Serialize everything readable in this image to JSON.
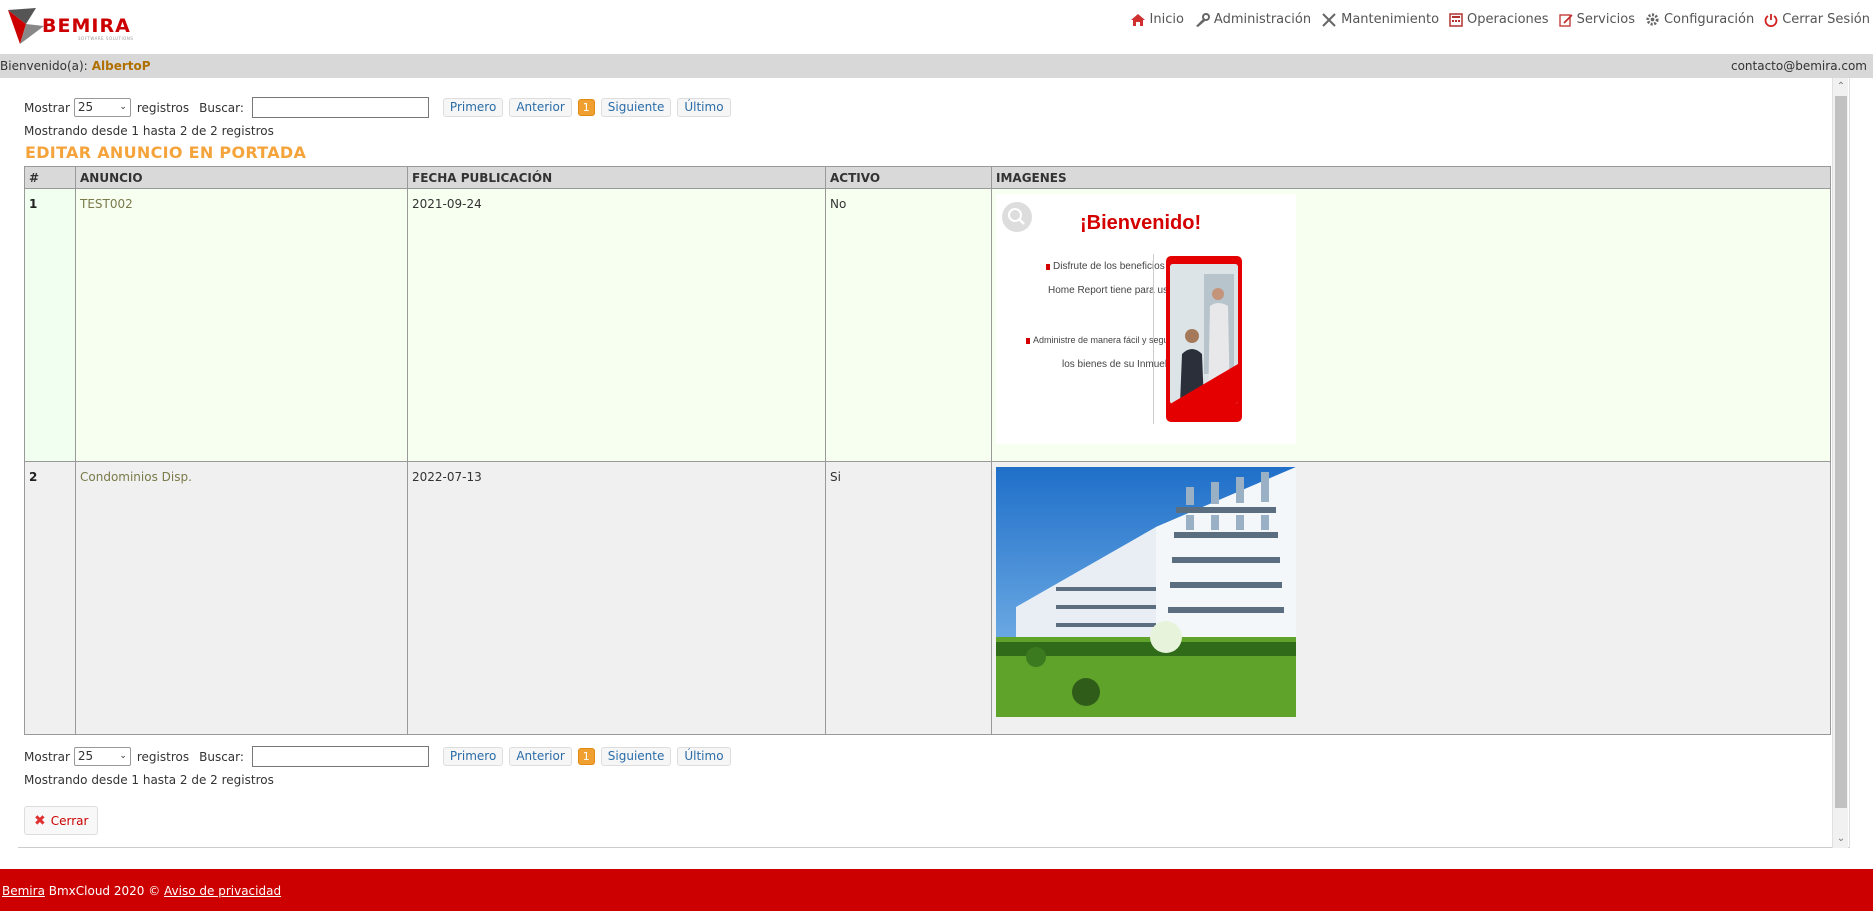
{
  "header": {
    "logo_text": "BEMIRA",
    "logo_sub": "SOFTWARE SOLUTIONS",
    "nav": [
      {
        "label": "Inicio",
        "icon": "home-icon"
      },
      {
        "label": "Administración",
        "icon": "wrench-icon"
      },
      {
        "label": "Mantenimiento",
        "icon": "tools-icon"
      },
      {
        "label": "Operaciones",
        "icon": "calculator-icon"
      },
      {
        "label": "Servicios",
        "icon": "edit-icon"
      },
      {
        "label": "Configuración",
        "icon": "gear-icon"
      },
      {
        "label": "Cerrar Sesión",
        "icon": "power-icon"
      }
    ]
  },
  "welcome": {
    "prefix": "Bienvenido(a):",
    "user": "AlbertoP",
    "email": "contacto@bemira.com"
  },
  "controls": {
    "show_label": "Mostrar",
    "page_size": "25",
    "records_label": "registros",
    "search_label": "Buscar:",
    "search_value": "",
    "first": "Primero",
    "prev": "Anterior",
    "current_page": "1",
    "next": "Siguiente",
    "last": "Último",
    "info": "Mostrando desde 1 hasta 2 de 2 registros"
  },
  "section_title": "EDITAR ANUNCIO EN PORTADA",
  "table": {
    "headers": [
      "#",
      "ANUNCIO",
      "FECHA PUBLICACIÓN",
      "ACTIVO",
      "IMAGENES"
    ],
    "rows": [
      {
        "num": "1",
        "anuncio": "TEST002",
        "fecha": "2021-09-24",
        "activo": "No"
      },
      {
        "num": "2",
        "anuncio": "Condominios Disp.",
        "fecha": "2022-07-13",
        "activo": "Si"
      }
    ],
    "image1": {
      "title": "¡Bienvenido!",
      "bullet1_line1": "Disfrute de los beneficios que",
      "bullet1_line2": "Home Report tiene para usted.",
      "bullet2_line1": "Administre de manera fácil y segura",
      "bullet2_line2": "los bienes de su Inmueble."
    }
  },
  "close_label": "Cerrar",
  "footer": {
    "brand": "Bemira",
    "text": " BmxCloud 2020 © ",
    "privacy": "Aviso de privacidad"
  },
  "colors": {
    "brand_red": "#cc0000",
    "title_orange": "#f5a33b",
    "page_current": "#f0a030"
  }
}
